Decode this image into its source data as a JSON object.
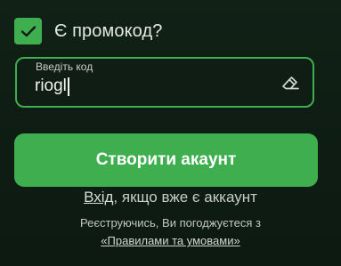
{
  "promo": {
    "checked": true,
    "label": "Є промокод?",
    "check_icon": "check-icon"
  },
  "code_field": {
    "label": "Введіть код",
    "value": "riogl",
    "clear_icon": "eraser-icon"
  },
  "submit": {
    "label": "Створити акаунт"
  },
  "login": {
    "link": "Вхід",
    "rest": ", якщо вже є аккаунт"
  },
  "terms": {
    "line1": "Реєструючись, Ви погоджуєтеся з",
    "link": "«Правилами та умовами»"
  },
  "colors": {
    "accent": "#3fae4f",
    "background": "#0e1c13"
  }
}
